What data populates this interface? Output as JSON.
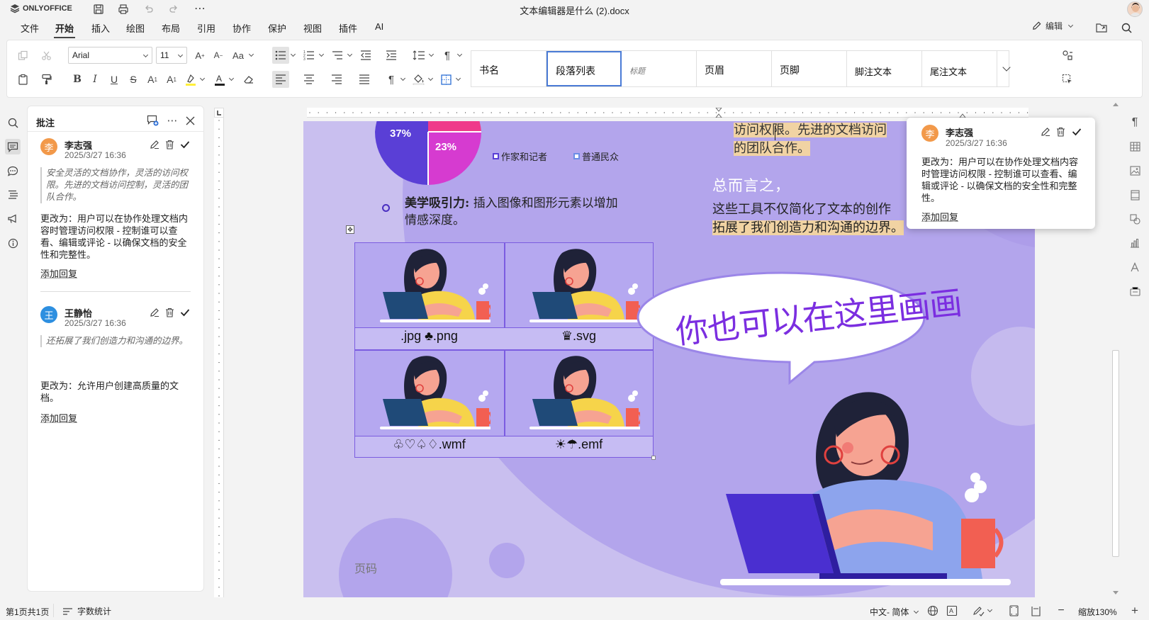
{
  "app": {
    "brand": "ONLYOFFICE",
    "doc_title": "文本编辑器是什么 (2).docx",
    "edit_mode": "编辑"
  },
  "menu": [
    "文件",
    "开始",
    "插入",
    "绘图",
    "布局",
    "引用",
    "协作",
    "保护",
    "视图",
    "插件",
    "AI"
  ],
  "active_menu": "开始",
  "ribbon": {
    "font_name": "Arial",
    "font_size": "11",
    "styles": [
      "书名",
      "段落列表",
      "标题",
      "页眉",
      "页脚",
      "脚注文本",
      "尾注文本"
    ],
    "selected_style": "段落列表"
  },
  "comments_panel": {
    "title": "批注",
    "comments": [
      {
        "author": "李志强",
        "initial": "李",
        "color": "#f2994a",
        "date": "2025/3/27 16:36",
        "quote": "安全灵活的文档协作，灵活的访问权限。先进的文档访问控制，灵活的团队合作。",
        "text": "更改为：用户可以在协作处理文档内容时管理访问权限 - 控制谁可以查看、编辑或评论 - 以确保文档的安全性和完整性。",
        "reply": "添加回复"
      },
      {
        "author": "王静怡",
        "initial": "王",
        "color": "#2d8fe0",
        "date": "2025/3/27 16:36",
        "quote": "还拓展了我们创造力和沟通的边界。",
        "text": "更改为：允许用户创建高质量的文档。",
        "reply": "添加回复"
      }
    ]
  },
  "popup_comment": {
    "author": "李志强",
    "initial": "李",
    "date": "2025/3/27 16:36",
    "text": "更改为：用户可以在协作处理文档内容时管理访问权限 - 控制谁可以查看、编辑或评论 - 以确保文档的安全性和完整性。",
    "reply": "添加回复"
  },
  "document": {
    "pie_labels": [
      "37%",
      "23%"
    ],
    "legend": [
      "作家和记者",
      "普通民众"
    ],
    "bullet_bold": "美学吸引力:",
    "bullet_text_1": "插入图像和图形元素以增加",
    "bullet_text_2": "情感深度。",
    "table_captions": [
      ".jpg ♣.png",
      "♛.svg",
      "♧♡♤♢.wmf",
      "☀☂.emf"
    ],
    "highlight_1": "访问权限。先进的文档访问",
    "highlight_2": "的团队合作。",
    "heading": "总而言之，",
    "para_1": "这些工具不仅简化了文本的创作",
    "para_2": "拓展了我们创造力和沟通的边界。",
    "callout": "你也可以在这里画画",
    "footer": "页码"
  },
  "status": {
    "page_info": "第1页共1页",
    "word_count": "字数统计",
    "language": "中文- 简体",
    "zoom": "缩放130%"
  },
  "colors": {
    "page_bg": "#c9bfef",
    "accent_purple": "#5a3fd6",
    "pie_magenta": "#d63bd0",
    "pie_pink": "#ef3a8a",
    "highlight": "#f1d3a3"
  }
}
